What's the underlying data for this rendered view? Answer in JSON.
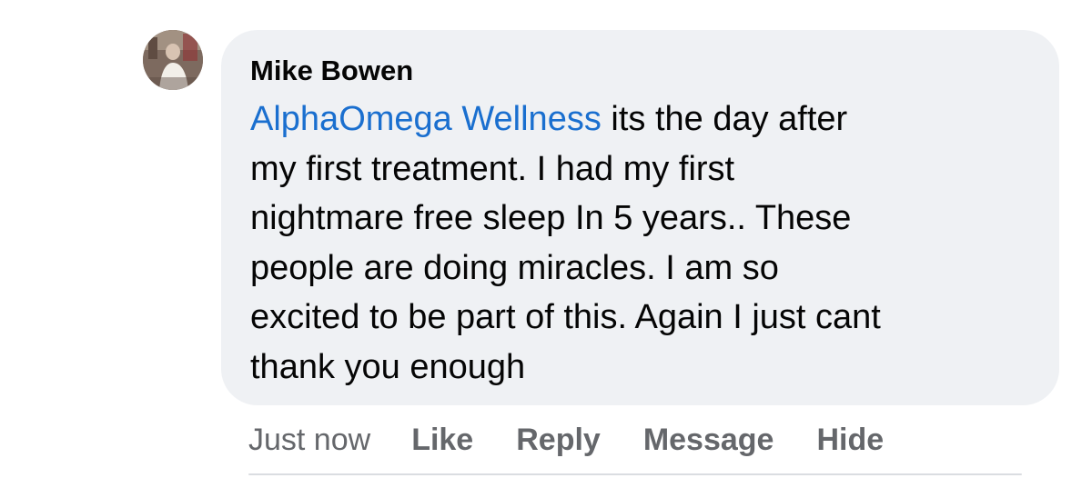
{
  "comment": {
    "author": "Mike Bowen",
    "mention": "AlphaOmega Wellness",
    "text_lines": [
      " its the day after",
      "my first treatment. I had my first",
      "nightmare free sleep In 5 years.. These",
      "people are doing miracles. I am so",
      "excited to be part of this. Again I just cant",
      "thank you enough"
    ],
    "timestamp": "Just now",
    "actions": {
      "like": "Like",
      "reply": "Reply",
      "message": "Message",
      "hide": "Hide"
    }
  },
  "colors": {
    "bubble_background": "#eff1f4",
    "mention_link": "#1a6fcf",
    "primary_text": "#050505",
    "secondary_text": "#65676b"
  }
}
